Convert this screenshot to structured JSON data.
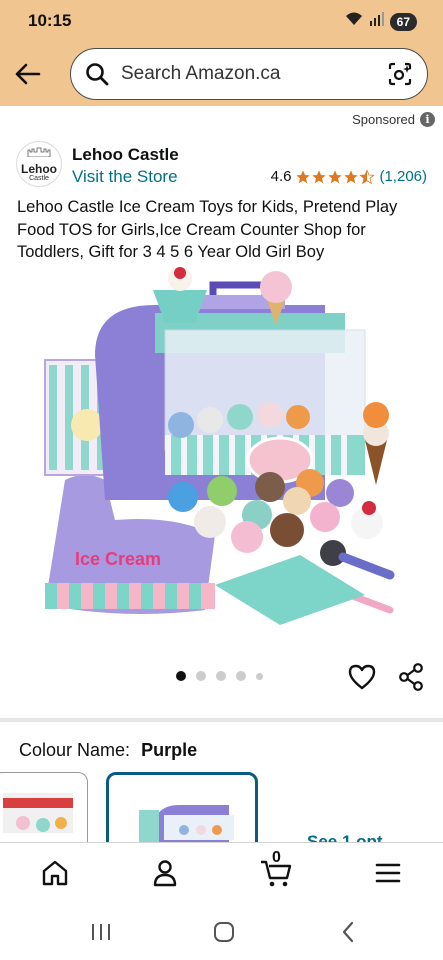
{
  "status": {
    "time": "10:15",
    "battery": "67"
  },
  "search": {
    "placeholder": "Search Amazon.ca"
  },
  "ad": {
    "sponsored_label": "Sponsored"
  },
  "brand": {
    "logo_text": "Lehoo",
    "logo_subtext": "Castle",
    "name": "Lehoo Castle",
    "visit_store": "Visit the Store"
  },
  "rating": {
    "value": "4.6",
    "count": "(1,206)",
    "stars_filled": 4.5,
    "star_color": "#de7921"
  },
  "product": {
    "title": "Lehoo Castle Ice Cream Toys for Kids, Pretend Play Food TOS for Girls,Ice Cream Counter Shop for Toddlers, Gift for 3 4 5 6 Year Old Girl Boy",
    "image_label": "Ice Cream"
  },
  "gallery": {
    "total_dots": 5,
    "active_index": 0
  },
  "variant": {
    "label": "Colour Name:",
    "value": "Purple",
    "see_more": "See 1 opt"
  },
  "nav": {
    "cart_count": "0",
    "icons": [
      "home-icon",
      "account-icon",
      "cart-icon",
      "menu-icon"
    ]
  },
  "colors": {
    "header": "#f1c58f",
    "link": "#007185",
    "selected_border": "#0a5b83",
    "star": "#de7921"
  }
}
